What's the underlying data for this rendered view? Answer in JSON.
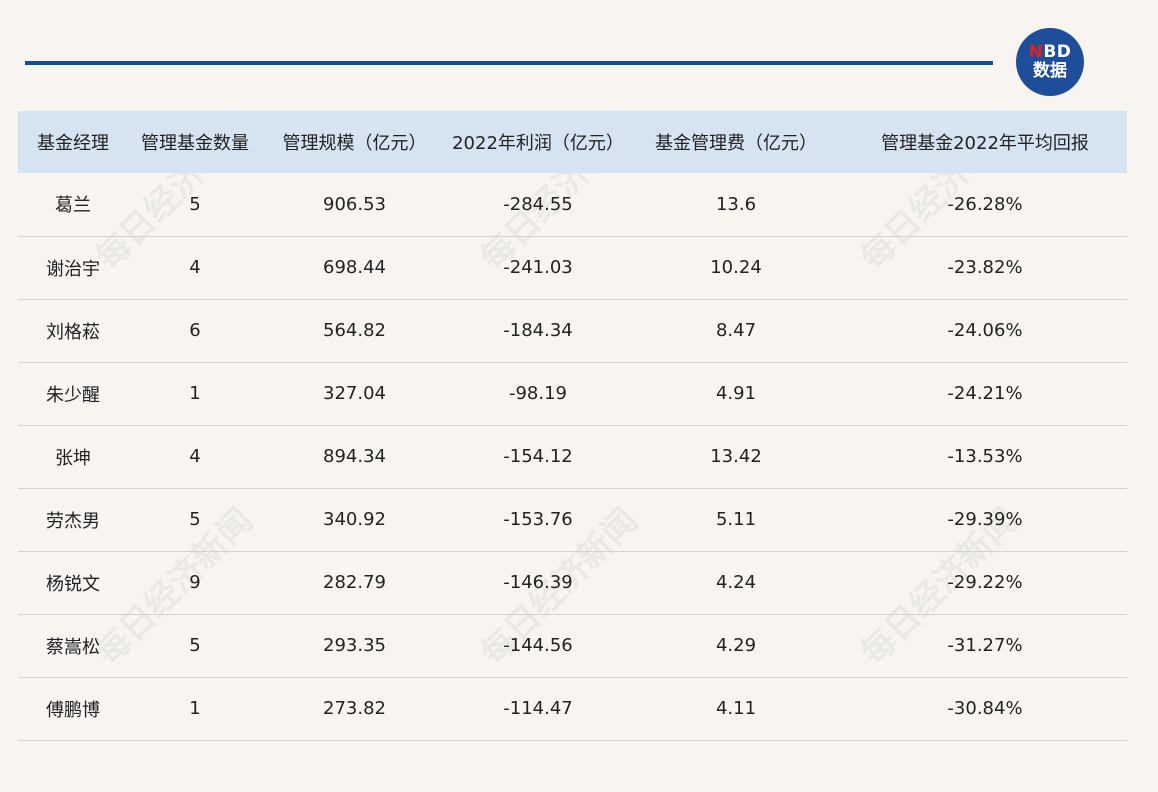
{
  "logo": {
    "brand_n": "N",
    "brand_rest": "BD",
    "tag": "数据"
  },
  "watermark": "每日经济新闻",
  "table": {
    "headers": [
      "基金经理",
      "管理基金数量",
      "管理规模（亿元）",
      "2022年利润（亿元）",
      "基金管理费（亿元）",
      "管理基金2022年平均回报"
    ],
    "rows": [
      [
        "葛兰",
        "5",
        "906.53",
        "-284.55",
        "13.6",
        "-26.28%"
      ],
      [
        "谢治宇",
        "4",
        "698.44",
        "-241.03",
        "10.24",
        "-23.82%"
      ],
      [
        "刘格菘",
        "6",
        "564.82",
        "-184.34",
        "8.47",
        "-24.06%"
      ],
      [
        "朱少醒",
        "1",
        "327.04",
        "-98.19",
        "4.91",
        "-24.21%"
      ],
      [
        "张坤",
        "4",
        "894.34",
        "-154.12",
        "13.42",
        "-13.53%"
      ],
      [
        "劳杰男",
        "5",
        "340.92",
        "-153.76",
        "5.11",
        "-29.39%"
      ],
      [
        "杨锐文",
        "9",
        "282.79",
        "-146.39",
        "4.24",
        "-29.22%"
      ],
      [
        "蔡嵩松",
        "5",
        "293.35",
        "-144.56",
        "4.29",
        "-31.27%"
      ],
      [
        "傅鹏博",
        "1",
        "273.82",
        "-114.47",
        "4.11",
        "-30.84%"
      ]
    ]
  },
  "colors": {
    "accent": "#0e4f9e",
    "header_bg": "#d6e4f1",
    "logo_bg": "#1e4d9a",
    "logo_n": "#e02020"
  }
}
